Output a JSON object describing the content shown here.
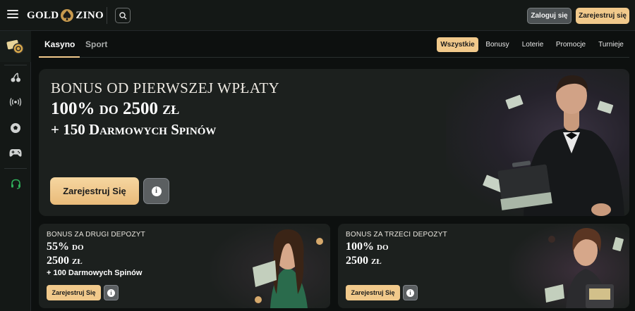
{
  "header": {
    "logo_left": "GOLD",
    "logo_right": "ZINO",
    "login_label": "Zaloguj się",
    "register_label": "Zarejestruj się"
  },
  "sidebar": {
    "icons": [
      "casino-chips-icon",
      "cherries-icon",
      "live-broadcast-icon",
      "soccer-ball-icon",
      "gamepad-icon",
      "support-headset-icon"
    ]
  },
  "tabs": [
    {
      "label": "Kasyno",
      "active": true
    },
    {
      "label": "Sport",
      "active": false
    }
  ],
  "filters": [
    {
      "label": "Wszystkie",
      "active": true
    },
    {
      "label": "Bonusy",
      "active": false
    },
    {
      "label": "Loterie",
      "active": false
    },
    {
      "label": "Promocje",
      "active": false
    },
    {
      "label": "Turnieje",
      "active": false
    }
  ],
  "hero": {
    "title": "BONUS OD PIERWSZEJ WPŁATY",
    "line2": "100% do 2500 zł",
    "line3": "+ 150 Darmowych Spinów",
    "cta": "Zarejestruj Się"
  },
  "cards": [
    {
      "label": "BONUS ZA DRUGI DEPOZYT",
      "line1": "55% do",
      "line2": "2500 zł",
      "line3": "+ 100 Darmowych Spinów",
      "cta": "Zarejestruj Się"
    },
    {
      "label": "BONUS ZA TRZECI DEPOZYT",
      "line1": "100% do",
      "line2": "2500 zł",
      "cta": "Zarejestruj Się"
    }
  ],
  "colors": {
    "accent": "#f1c98b",
    "background": "#0d100f",
    "panel": "#1c201e",
    "support_icon": "#2fae5a"
  }
}
